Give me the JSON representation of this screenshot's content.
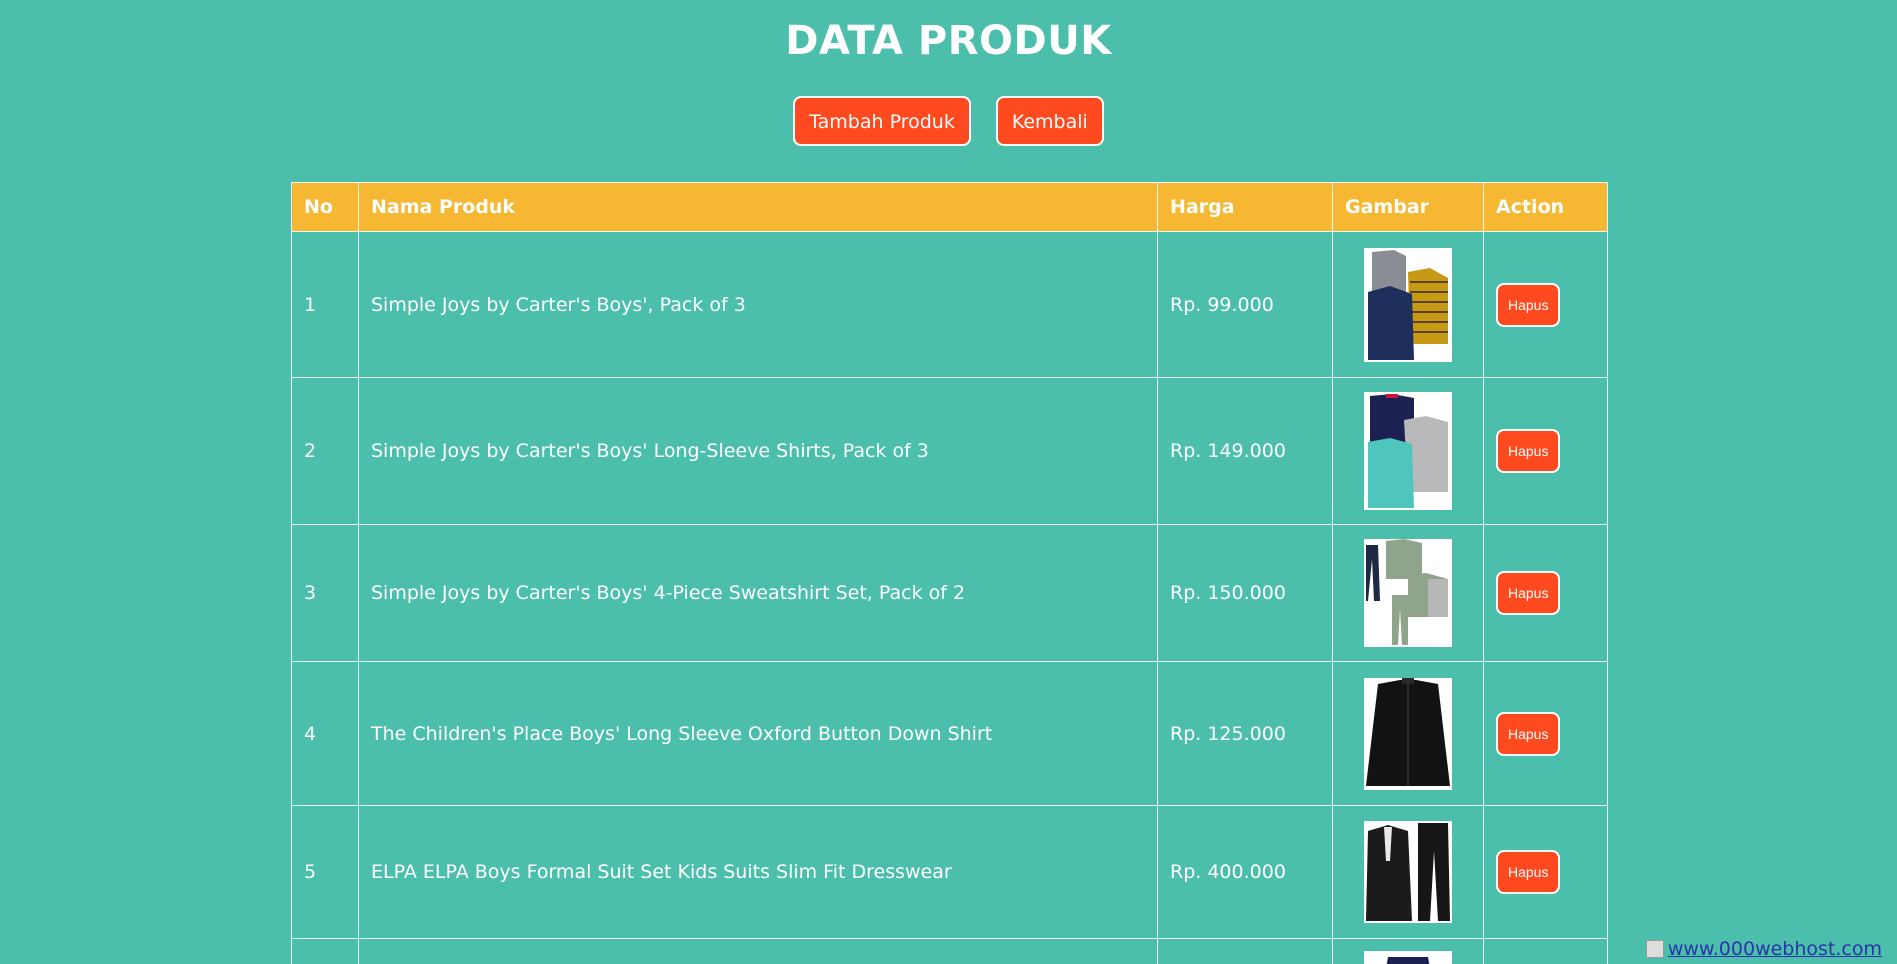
{
  "page": {
    "title": "DATA PRODUK",
    "add_button": "Tambah Produk",
    "back_button": "Kembali"
  },
  "table": {
    "headers": [
      "No",
      "Nama Produk",
      "Harga",
      "Gambar",
      "Action"
    ],
    "rows": [
      {
        "no": "1",
        "name": "Simple Joys by Carter's Boys', Pack of 3",
        "price": "Rp. 99.000",
        "image": "product-thumbnail-striped-shirts",
        "action": "Hapus"
      },
      {
        "no": "2",
        "name": "Simple Joys by Carter's Boys' Long-Sleeve Shirts, Pack of 3",
        "price": "Rp. 149.000",
        "image": "product-thumbnail-longsleeve-shirts",
        "action": "Hapus"
      },
      {
        "no": "3",
        "name": "Simple Joys by Carter's Boys' 4-Piece Sweatshirt Set, Pack of 2",
        "price": "Rp. 150.000",
        "image": "product-thumbnail-sweatshirt-set",
        "action": "Hapus"
      },
      {
        "no": "4",
        "name": "The Children's Place Boys' Long Sleeve Oxford Button Down Shirt",
        "price": "Rp. 125.000",
        "image": "product-thumbnail-black-shirt",
        "action": "Hapus"
      },
      {
        "no": "5",
        "name": "ELPA ELPA Boys Formal Suit Set Kids Suits Slim Fit Dresswear",
        "price": "Rp. 400.000",
        "image": "product-thumbnail-formal-suit",
        "action": "Hapus"
      }
    ]
  },
  "footer": {
    "link_text": "www.000webhost.com"
  },
  "colors": {
    "background": "#4bbfac",
    "header_bg": "#f6b733",
    "button": "#fe4a1e"
  }
}
